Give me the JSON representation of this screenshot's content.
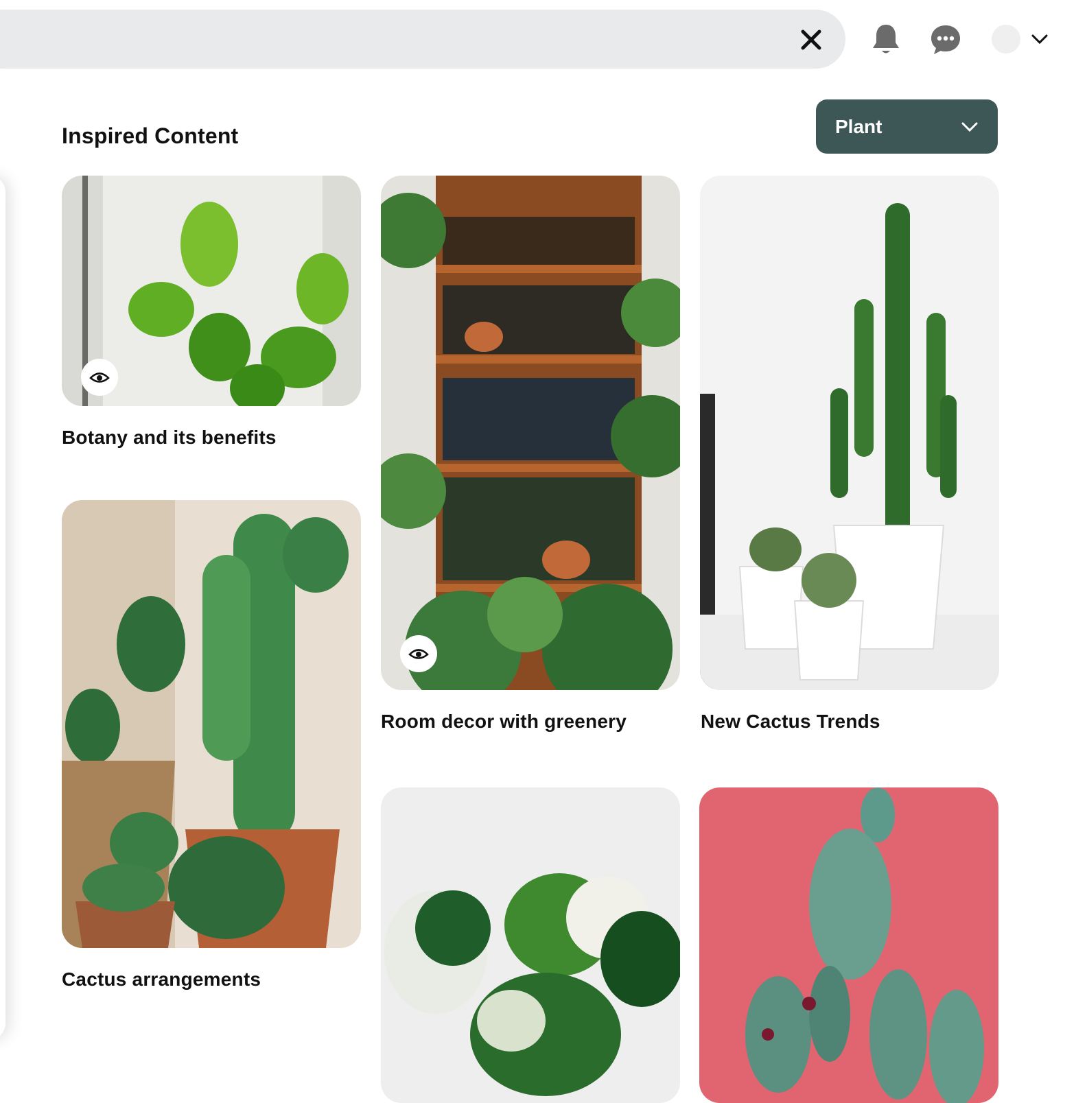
{
  "header": {
    "search_icon": "close-icon",
    "notifications_icon": "bell-icon",
    "messages_icon": "chat-bubble-icon",
    "account_icon": "chevron-down-icon"
  },
  "section": {
    "title": "Inspired Content",
    "filter": {
      "selected": "Plant",
      "icon": "chevron-down-icon",
      "color": "#3d5656"
    }
  },
  "cards": [
    {
      "caption": "Botany and its benefits"
    },
    {
      "caption": "Room decor with greenery"
    },
    {
      "caption": "New Cactus Trends"
    },
    {
      "caption": "Cactus arrangements"
    },
    {
      "caption": ""
    },
    {
      "caption": ""
    }
  ]
}
